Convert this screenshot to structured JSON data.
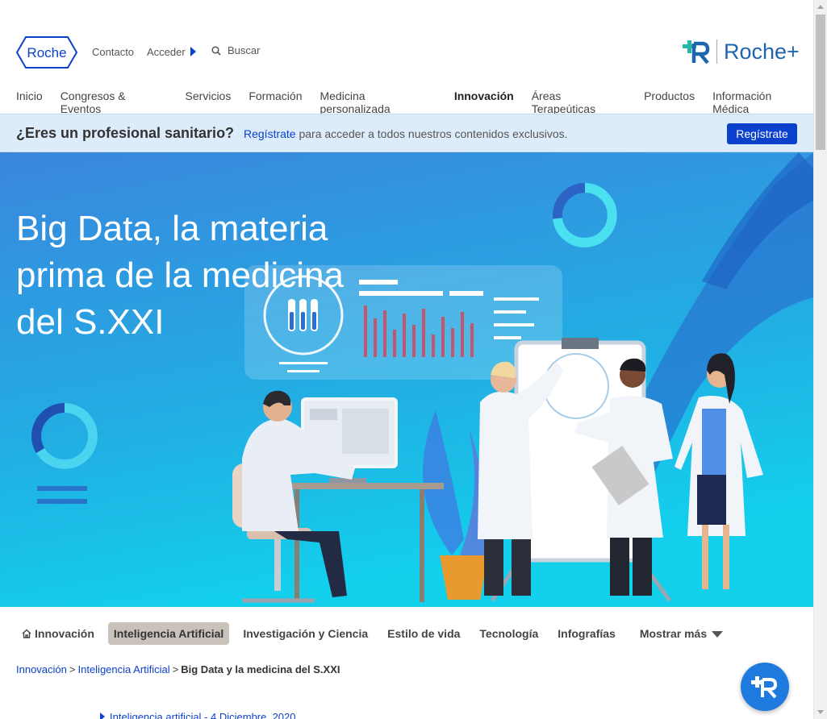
{
  "header": {
    "logo_text": "Roche",
    "contacto": "Contacto",
    "acceder": "Acceder",
    "search_label": "Buscar",
    "roche_plus": "Roche+"
  },
  "nav": [
    {
      "label": "Inicio",
      "active": false
    },
    {
      "label": "Congresos & Eventos",
      "active": false
    },
    {
      "label": "Servicios",
      "active": false
    },
    {
      "label": "Formación",
      "active": false
    },
    {
      "label": "Medicina personalizada",
      "active": false
    },
    {
      "label": "Innovación",
      "active": true
    },
    {
      "label": "Áreas Terapeúticas",
      "active": false
    },
    {
      "label": "Productos",
      "active": false
    },
    {
      "label": "Información Médica",
      "active": false
    }
  ],
  "pro_banner": {
    "question": "¿Eres un profesional sanitario?",
    "link": "Regístrate",
    "message": " para acceder a todos nuestros contenidos exclusivos.",
    "button": "Regístrate"
  },
  "hero": {
    "title": "Big Data, la materia prima de la medicina del S.XXI"
  },
  "tabs": [
    {
      "label": "Innovación",
      "active": false
    },
    {
      "label": "Inteligencia Artificial",
      "active": true
    },
    {
      "label": "Investigación y Ciencia",
      "active": false
    },
    {
      "label": "Estilo de vida",
      "active": false
    },
    {
      "label": "Tecnología",
      "active": false
    },
    {
      "label": "Infografías",
      "active": false
    },
    {
      "label": "Mostrar más",
      "active": false
    }
  ],
  "breadcrumb": {
    "items": [
      "Innovación",
      "Inteligencia Artificial"
    ],
    "separator": ">",
    "current": "Big Data y la medicina del S.XXI"
  },
  "meta": {
    "text": "Inteligencia artificial - 4 Diciembre, 2020"
  },
  "colors": {
    "accent": "#0b41cd",
    "banner_bg": "#ddecfa",
    "hero_top": "#3a8ee0",
    "hero_bottom": "#19c9e8",
    "tab_active_bg": "#c9c2bb"
  }
}
